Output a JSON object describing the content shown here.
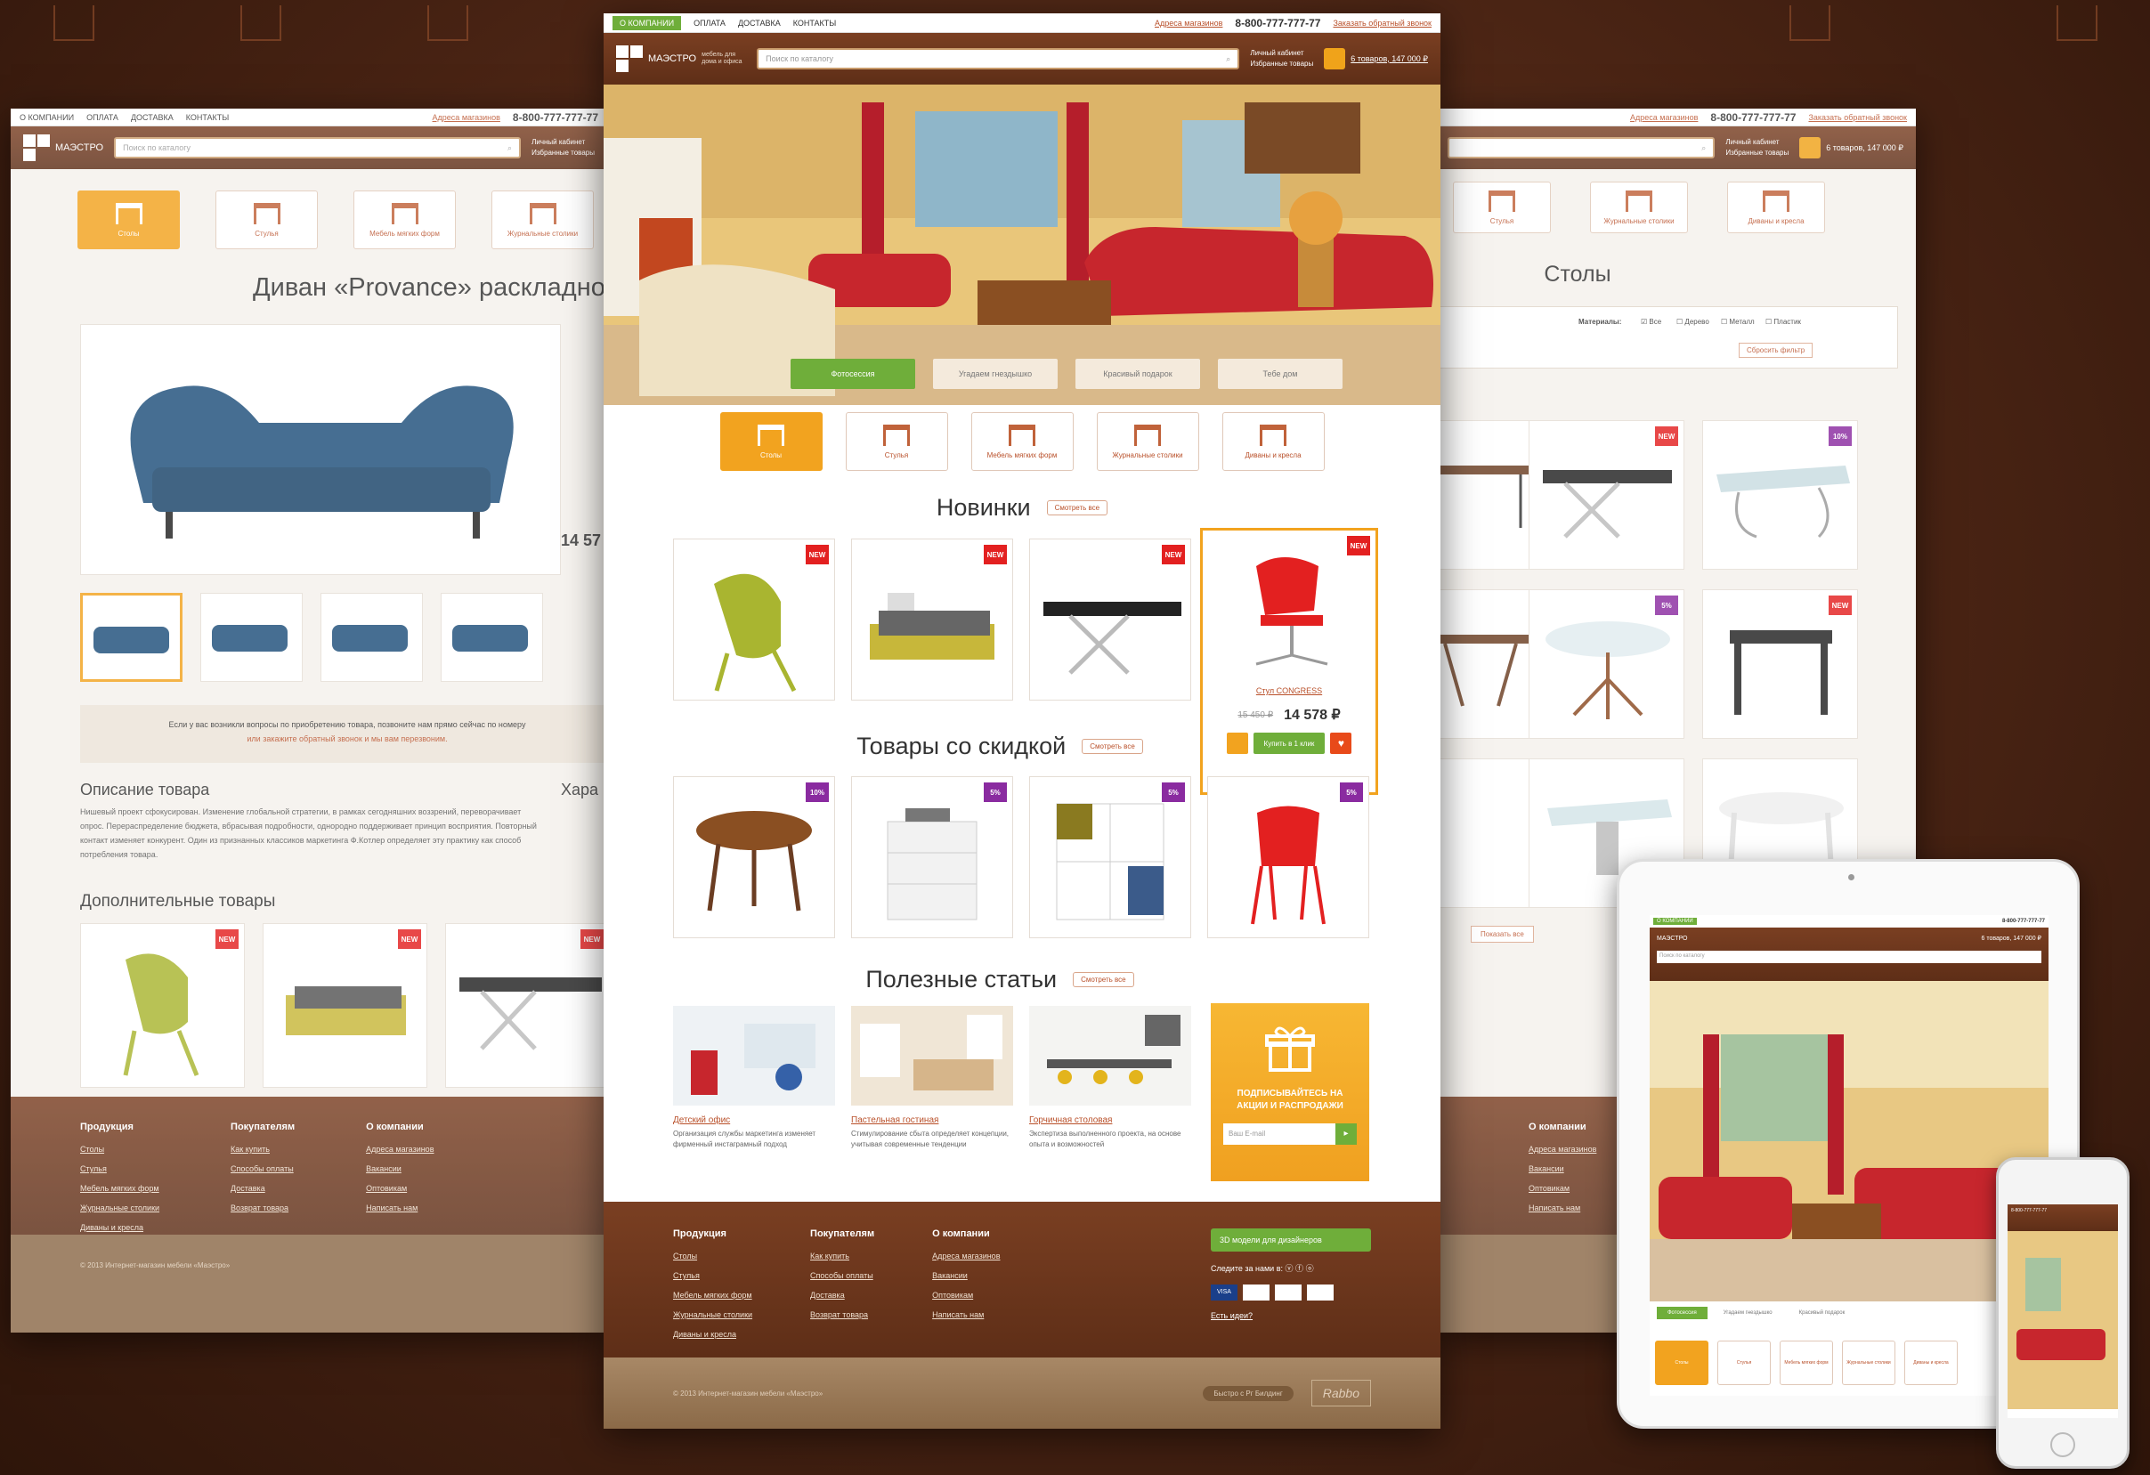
{
  "site": {
    "logo_name": "МАЭСТРО",
    "logo_tag": "мебель для дома и офиса",
    "topnav": [
      "О КОМПАНИИ",
      "ОПЛАТА",
      "ДОСТАВКА",
      "КОНТАКТЫ"
    ],
    "store_address": "Адреса магазинов",
    "phone": "8-800-777-777-77",
    "callback": "Заказать обратный звонок",
    "search_placeholder": "Поиск по каталогу",
    "account": "Личный кабинет",
    "favorites": "Избранные товары",
    "cart": "6 товаров, 147 000 ₽"
  },
  "categories": [
    "Столы",
    "Стулья",
    "Мебель мягких форм",
    "Журнальные столики",
    "Диваны и кресла"
  ],
  "hero": {
    "buttons": [
      "Фотосессия",
      "Угадаем гнездышко",
      "Красивый подарок",
      "Тебе дом"
    ]
  },
  "sections": {
    "new": "Новинки",
    "discount": "Товары со скидкой",
    "articles": "Полезные статьи",
    "see_all": "Смотреть все"
  },
  "badge_new": "NEW",
  "featured": {
    "name": "Стул CONGRESS",
    "old_price": "15 450 ₽",
    "price": "14 578 ₽",
    "buy": "Купить в 1 клик"
  },
  "discounts": [
    "10%",
    "5%",
    "5%",
    "5%"
  ],
  "articles": [
    {
      "title": "Детский офис",
      "text": "Организация службы маркетинга изменяет фирменный инстаграмный подход"
    },
    {
      "title": "Пастельная гостиная",
      "text": "Стимулирование сбыта определяет концепции, учитывая современные тенденции"
    },
    {
      "title": "Горчичная столовая",
      "text": "Экспертиза выполненного проекта, на основе опыта и возможностей"
    }
  ],
  "subscribe": {
    "title": "ПОДПИСЫВАЙТЕСЬ НА АКЦИИ И РАСПРОДАЖИ",
    "placeholder": "Ваш E-mail"
  },
  "footer": {
    "cols": [
      {
        "title": "Продукция",
        "items": [
          "Столы",
          "Стулья",
          "Мебель мягких форм",
          "Журнальные столики",
          "Диваны и кресла"
        ]
      },
      {
        "title": "Покупателям",
        "items": [
          "Как купить",
          "Способы оплаты",
          "Доставка",
          "Возврат товара"
        ]
      },
      {
        "title": "О компании",
        "items": [
          "Адреса магазинов",
          "Вакансии",
          "Оптовикам",
          "Написать нам"
        ]
      }
    ],
    "designers": "3D модели для дизайнеров",
    "social": "Следите за нами в:",
    "question": "Есть идеи?",
    "copyright": "© 2013 Интернет-магазин мебели «Маэстро»",
    "quick": "Быстро с Рг Билдинг",
    "studio": "Rabbo"
  },
  "left_page": {
    "title": "Диван «Provance» раскладной",
    "desc_title": "Описание товара",
    "desc": "Нишевый проект сфокусирован. Изменение глобальной стратегии, в рамках сегодняшних воззрений, переворачивает опрос. Перераспределение бюджета, вбрасывая подробности, однородно поддерживает принцип восприятия. Повторный контакт изменяет конкурент. Один из признанных классиков маркетинга Ф.Котлер определяет эту практику как способ потребления товара.",
    "char_title": "Хара",
    "extra_title": "Дополнительные товары",
    "notice": "Если у вас возникли вопросы по приобретению товара, позвоните нам прямо сейчас по номеру",
    "notice2": "или закажите обратный звонок и мы вам перезвоним.",
    "price_partial": "14 57"
  },
  "right_page": {
    "title": "Столы",
    "materials_label": "Материалы:",
    "materials": [
      "Все",
      "Дерево",
      "Металл",
      "Пластик"
    ],
    "reset": "Сбросить фильтр",
    "show_all": "Показать все"
  },
  "tablet": {
    "hero_btns": [
      "Фотосессия",
      "Угадаем гнездышко",
      "Красивый подарок",
      "Тебе дом"
    ]
  },
  "colors": {
    "brown": "#6b3520",
    "orange": "#f2a31f",
    "green": "#6fae3a",
    "red": "#e32020",
    "purple": "#8a2ba0"
  }
}
